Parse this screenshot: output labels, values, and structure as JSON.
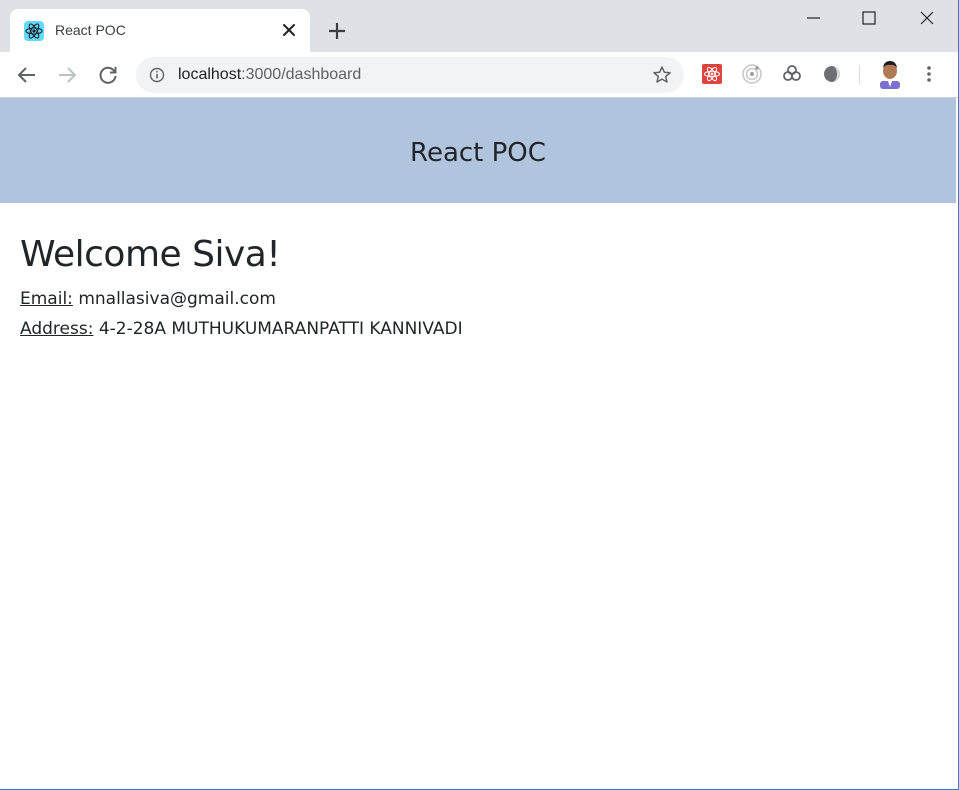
{
  "browser": {
    "tab": {
      "title": "React POC",
      "favicon": "react-icon"
    },
    "address_bar": {
      "host": "localhost",
      "rest": ":3000/dashboard"
    },
    "extensions": [
      "react-devtools-icon",
      "target-icon",
      "chain-icon",
      "gray-sphere-icon"
    ],
    "colors": {
      "tabstrip": "#dee1e6",
      "omnibox": "#f1f3f4"
    }
  },
  "app": {
    "header_title": "React POC",
    "header_bg": "#b0c4de",
    "welcome": "Welcome Siva!",
    "email_label": "Email:",
    "email_value": "mnallasiva@gmail.com",
    "address_label": "Address:",
    "address_value": "4-2-28A MUTHUKUMARANPATTI KANNIVADI"
  }
}
